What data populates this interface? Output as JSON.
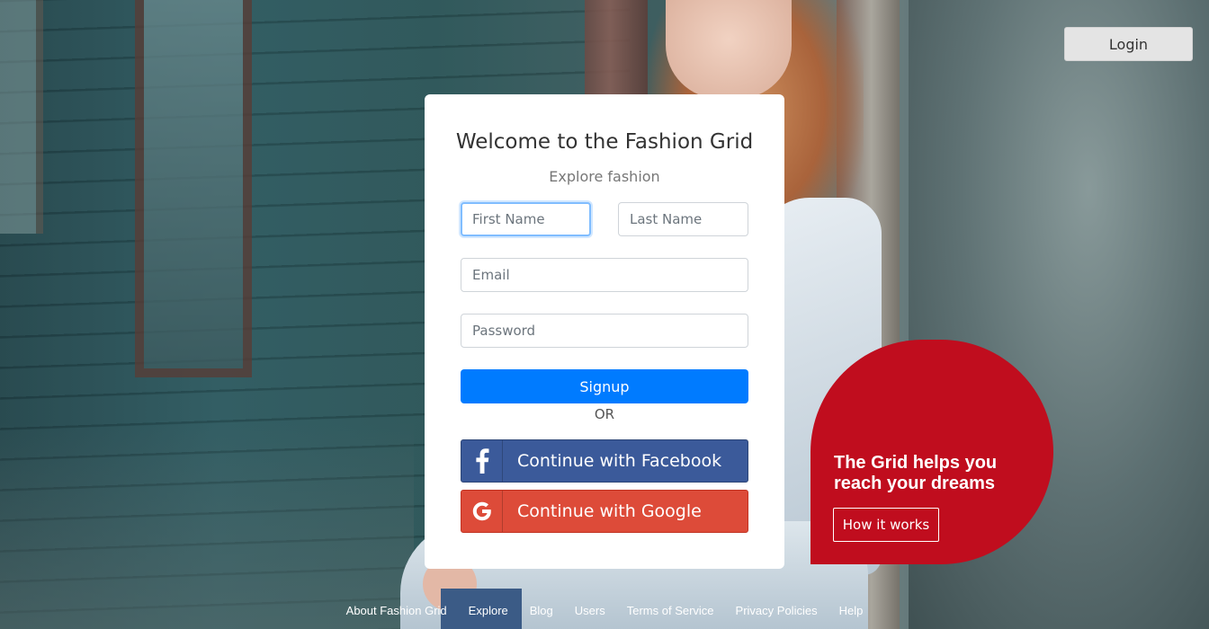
{
  "header": {
    "login_label": "Login"
  },
  "signup_card": {
    "title": "Welcome to the Fashion Grid",
    "subtitle": "Explore fashion",
    "first_name_placeholder": "First Name",
    "last_name_placeholder": "Last Name",
    "email_placeholder": "Email",
    "password_placeholder": "Password",
    "signup_label": "Signup",
    "or_label": "OR",
    "facebook_label": "Continue with Facebook",
    "google_label": "Continue with Google"
  },
  "promo": {
    "title": "The Grid helps you reach your dreams",
    "button_label": "How it works"
  },
  "footer": {
    "links": [
      "About Fashion Grid",
      "Explore",
      "Blog",
      "Users",
      "Terms of Service",
      "Privacy Policies",
      "Help"
    ]
  },
  "colors": {
    "primary": "#007bff",
    "facebook": "#3b5a9a",
    "google": "#dd4b39",
    "promo": "#c00d1e"
  },
  "icons": {
    "facebook": "facebook-icon",
    "google": "google-icon"
  }
}
